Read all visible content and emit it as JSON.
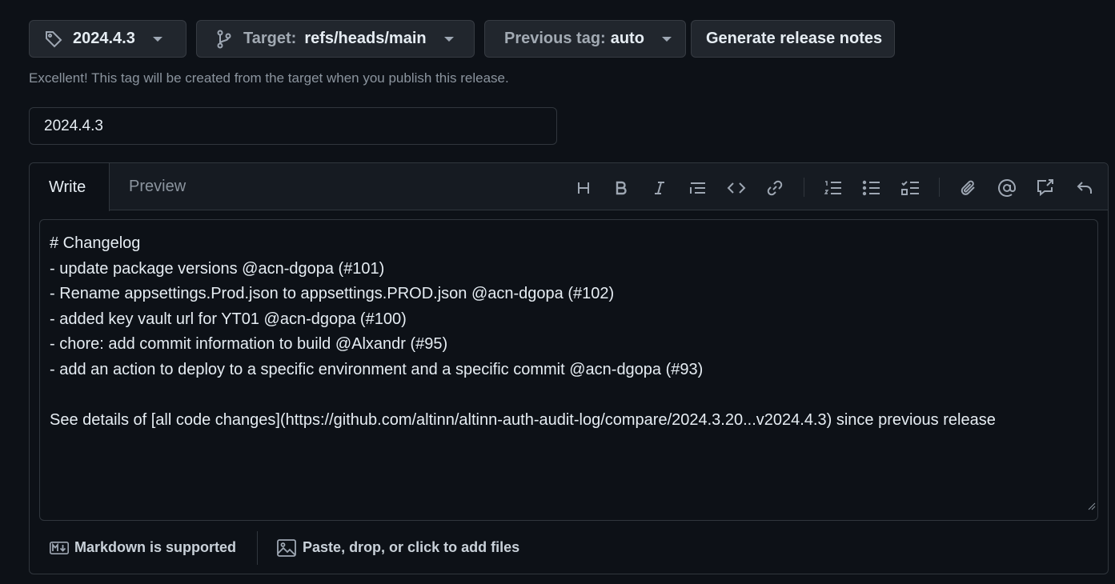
{
  "toolbar": {
    "tag_button": {
      "label": "2024.4.3",
      "icon": "tag-icon"
    },
    "target_button": {
      "prefix": "Target:",
      "value": "refs/heads/main",
      "icon": "git-branch-icon"
    },
    "previous_tag_button": {
      "prefix": "Previous tag:",
      "value": "auto"
    },
    "generate_button": {
      "label": "Generate release notes"
    }
  },
  "tag_note": "Excellent! This tag will be created from the target when you publish this release.",
  "release_title": {
    "value": "2024.4.3"
  },
  "editor": {
    "tabs": [
      {
        "label": "Write",
        "active": true
      },
      {
        "label": "Preview",
        "active": false
      }
    ],
    "tools": [
      "heading-icon",
      "bold-icon",
      "italic-icon",
      "quote-icon",
      "code-icon",
      "link-icon",
      "ordered-list-icon",
      "unordered-list-icon",
      "task-list-icon",
      "attach-icon",
      "mention-icon",
      "reference-icon",
      "undo-icon"
    ],
    "body_lines": [
      "# Changelog",
      "- update package versions @acn-dgopa (#101)",
      "- Rename appsettings.Prod.json to appsettings.PROD.json @acn-dgopa (#102)",
      "- added key vault url for YT01 @acn-dgopa (#100)",
      "- chore: add commit information to build @Alxandr (#95)",
      "- add an action to deploy to a specific environment and a specific commit @acn-dgopa (#93)",
      "",
      "See details of [all code changes](https://github.com/altinn/altinn-auth-audit-log/compare/2024.3.20...v2024.4.3) since previous release"
    ],
    "footer": {
      "markdown_label": "Markdown is supported",
      "attach_label": "Paste, drop, or click to add files"
    }
  },
  "colors": {
    "background": "#0d1117",
    "button": "#21262d",
    "border": "#30363d",
    "muted_text": "#8b949e"
  }
}
